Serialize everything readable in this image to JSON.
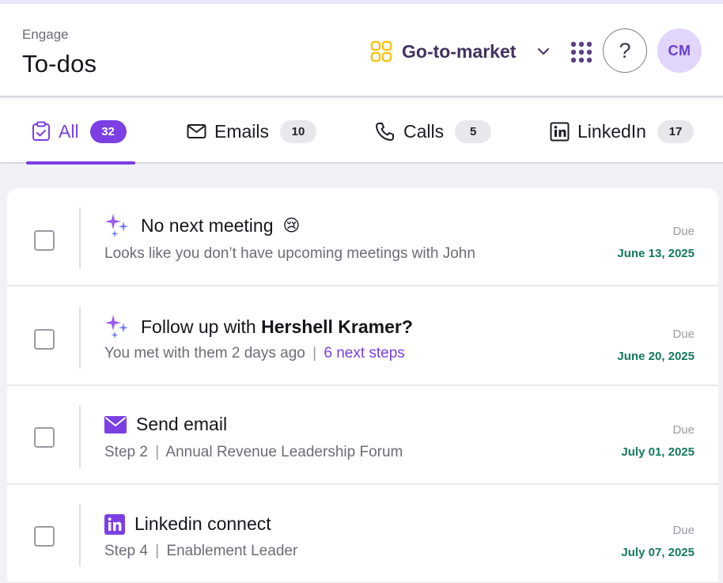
{
  "header": {
    "eyebrow": "Engage",
    "title": "To-dos",
    "workspace": "Go-to-market",
    "help_label": "?",
    "avatar_initials": "CM"
  },
  "tabs": [
    {
      "label": "All",
      "count": "32",
      "active": true,
      "icon": "clipboard-check-icon"
    },
    {
      "label": "Emails",
      "count": "10",
      "active": false,
      "icon": "mail-icon"
    },
    {
      "label": "Calls",
      "count": "5",
      "active": false,
      "icon": "phone-icon"
    },
    {
      "label": "LinkedIn",
      "count": "17",
      "active": false,
      "icon": "linkedin-icon"
    }
  ],
  "todos": [
    {
      "icon": "ai-sparkle-icon",
      "title": "No next meeting",
      "emoji": "😢",
      "subtitle": "Looks like you don’t have upcoming meetings with John",
      "due_label": "Due",
      "due_date": "June 13, 2025"
    },
    {
      "icon": "ai-sparkle-icon",
      "title_prefix": "Follow up with",
      "title_bold": "Hershell Kramer?",
      "subtitle": "You met with them 2 days ago",
      "separator": "|",
      "link": "6 next steps",
      "due_label": "Due",
      "due_date": "June 20, 2025"
    },
    {
      "icon": "mail-filled-icon",
      "title": "Send email",
      "step": "Step 2",
      "separator": "|",
      "subtitle": "Annual Revenue Leadership Forum",
      "due_label": "Due",
      "due_date": "July 01, 2025"
    },
    {
      "icon": "linkedin-filled-icon",
      "title": "Linkedin connect",
      "step": "Step 4",
      "separator": "|",
      "subtitle": "Enablement Leader",
      "due_label": "Due",
      "due_date": "July 07, 2025"
    }
  ],
  "colors": {
    "accent": "#7b3fe4",
    "due_date": "#137a5b",
    "workspace_icon": "#f5c518"
  }
}
